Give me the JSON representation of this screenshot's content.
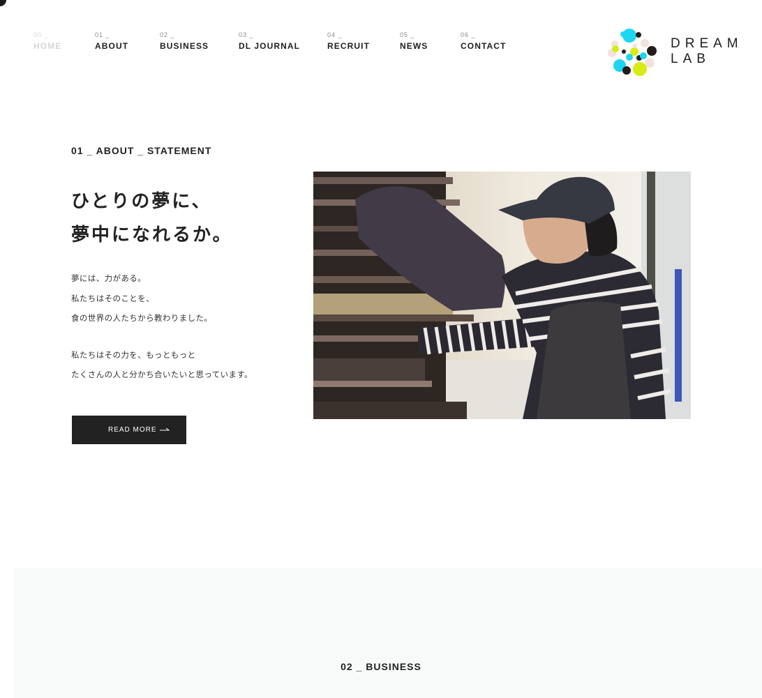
{
  "nav": {
    "items": [
      {
        "num": "00 _",
        "label": "HOME"
      },
      {
        "num": "01 _",
        "label": "ABOUT"
      },
      {
        "num": "02 _",
        "label": "BUSINESS"
      },
      {
        "num": "03 _",
        "label": "DL JOURNAL"
      },
      {
        "num": "04 _",
        "label": "RECRUIT"
      },
      {
        "num": "05 _",
        "label": "NEWS"
      },
      {
        "num": "06 _",
        "label": "CONTACT"
      }
    ]
  },
  "logo": {
    "line1": "DREAM",
    "line2": "LAB",
    "colors": [
      "#1ed6ef",
      "#d7ec12",
      "#241c1c",
      "#f3e1de"
    ]
  },
  "about": {
    "section_title": "01 _ ABOUT _ STATEMENT",
    "headline_line1": "ひとりの夢に、",
    "headline_line2": "夢中になれるか。",
    "paragraph1": [
      "夢には、力がある。",
      "私たちはそのことを、",
      "食の世界の人たちから教わりました。"
    ],
    "paragraph2": [
      "私たちはその力を、もっともっと",
      "たくさんの人と分かち合いたいと思っています。"
    ],
    "read_more_label": "READ MORE"
  },
  "business": {
    "section_title": "02 _ BUSINESS"
  },
  "colors": {
    "text": "#222222",
    "button_bg": "#222222",
    "button_text": "#ffffff",
    "muted_nav": "#d6d6d6",
    "section_bg": "#f8f9f9"
  }
}
